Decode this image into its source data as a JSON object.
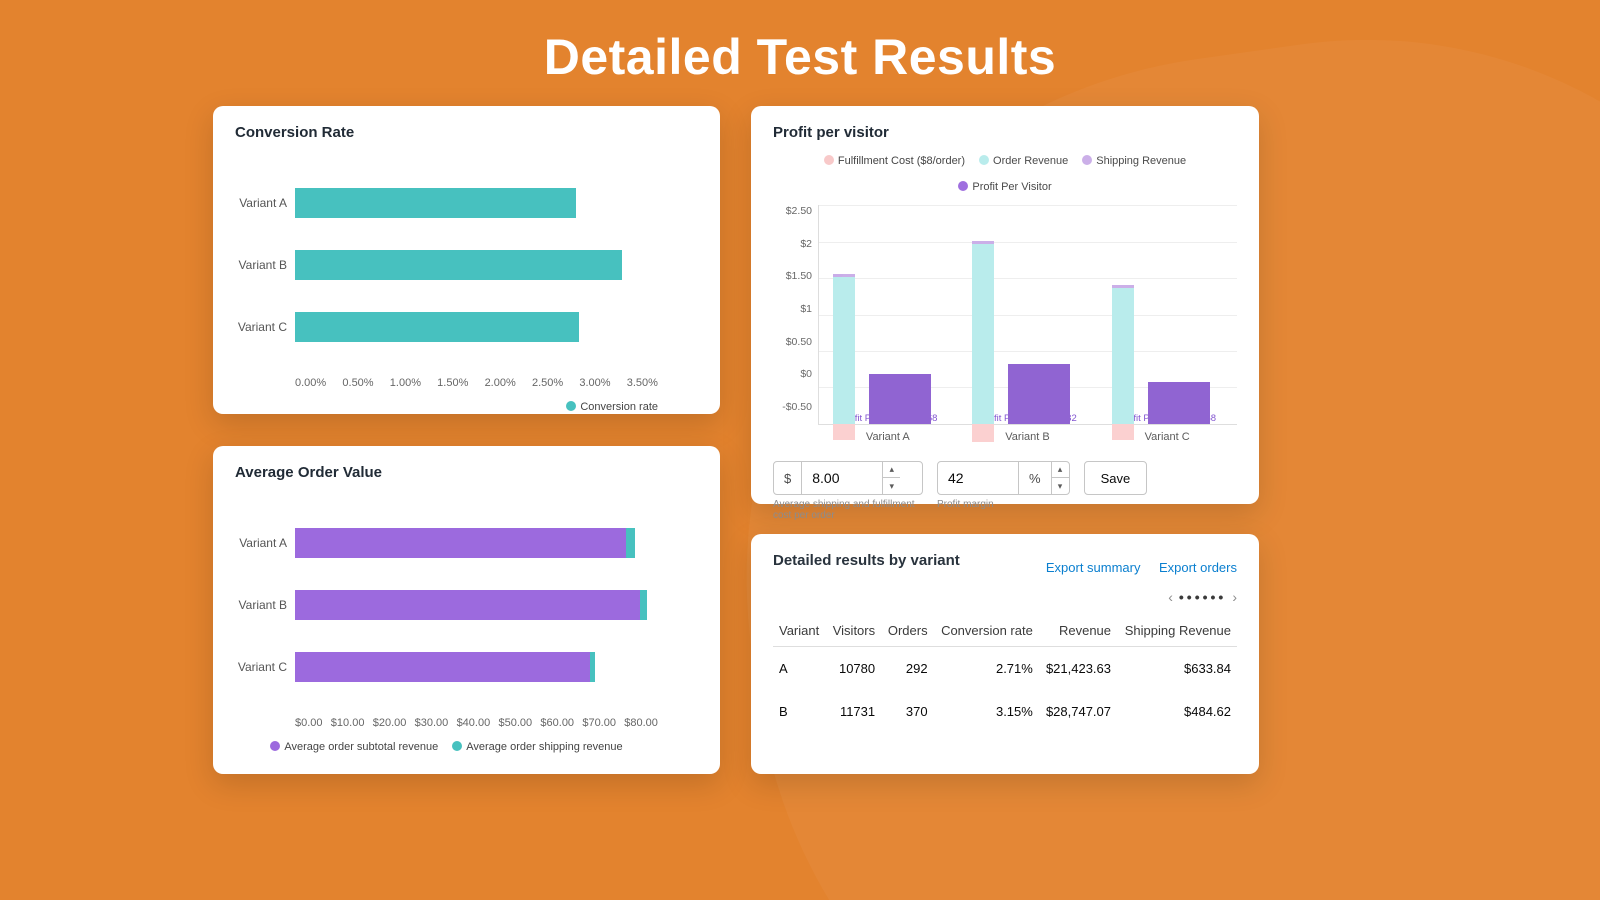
{
  "page_title": "Detailed Test Results",
  "chart_data": [
    {
      "id": "conversion_rate",
      "type": "bar",
      "orientation": "horizontal",
      "title": "Conversion Rate",
      "categories": [
        "Variant A",
        "Variant B",
        "Variant C"
      ],
      "series": [
        {
          "name": "Conversion rate",
          "color": "#47c1bf",
          "values": [
            0.0271,
            0.0315,
            0.0274
          ]
        }
      ],
      "xlabel": "",
      "ylabel": "",
      "xticks": [
        "0.00%",
        "0.50%",
        "1.00%",
        "1.50%",
        "2.00%",
        "2.50%",
        "3.00%",
        "3.50%"
      ],
      "xlim": [
        0,
        0.035
      ],
      "legend": [
        "Conversion rate"
      ]
    },
    {
      "id": "average_order_value",
      "type": "bar",
      "orientation": "horizontal",
      "stacked": true,
      "title": "Average Order Value",
      "categories": [
        "Variant A",
        "Variant B",
        "Variant C"
      ],
      "series": [
        {
          "name": "Average order subtotal revenue",
          "color": "#9c6ade",
          "values": [
            73,
            76,
            65
          ]
        },
        {
          "name": "Average order shipping revenue",
          "color": "#47c1bf",
          "values": [
            2,
            1.5,
            1
          ]
        }
      ],
      "xlabel": "",
      "ylabel": "",
      "xticks": [
        "$0.00",
        "$10.00",
        "$20.00",
        "$30.00",
        "$40.00",
        "$50.00",
        "$60.00",
        "$70.00",
        "$80.00"
      ],
      "xlim": [
        0,
        80
      ],
      "legend": [
        "Average order subtotal revenue",
        "Average order shipping revenue"
      ]
    },
    {
      "id": "profit_per_visitor",
      "type": "bar",
      "orientation": "vertical",
      "grouped": true,
      "title": "Profit per visitor",
      "categories": [
        "Variant A",
        "Variant B",
        "Variant C"
      ],
      "series": [
        {
          "name": "Fulfillment Cost ($8/order)",
          "color": "#fbcfcf",
          "values": [
            -0.22,
            -0.25,
            -0.22
          ]
        },
        {
          "name": "Order Revenue",
          "color": "#b7ecec",
          "values": [
            2.0,
            2.45,
            1.85
          ]
        },
        {
          "name": "Shipping Revenue",
          "color": "#c9ace8",
          "values": [
            0.05,
            0.04,
            0.04
          ]
        },
        {
          "name": "Profit Per Visitor",
          "color": "#8c5ed1",
          "values": [
            0.68,
            0.82,
            0.58
          ]
        }
      ],
      "annotations": [
        "Profit Per Visitor: $0.68",
        "Profit Per Visitor: $0.82",
        "Profit Per Visitor: $0.58"
      ],
      "yticks": [
        "$2.50",
        "$2",
        "$1.50",
        "$1",
        "$0.50",
        "$0",
        "-$0.50"
      ],
      "ylim": [
        -0.5,
        2.5
      ],
      "legend": [
        "Fulfillment Cost ($8/order)",
        "Order Revenue",
        "Shipping Revenue",
        "Profit Per Visitor"
      ]
    }
  ],
  "profit_inputs": {
    "cost_prefix": "$",
    "cost_value": "8.00",
    "cost_caption": "Average shipping and fulfillment cost per order",
    "margin_value": "42",
    "margin_suffix": "%",
    "margin_caption": "Profit margin",
    "save_label": "Save"
  },
  "results_table": {
    "title": "Detailed results by variant",
    "links": {
      "export_summary": "Export summary",
      "export_orders": "Export orders"
    },
    "columns": [
      "Variant",
      "Visitors",
      "Orders",
      "Conversion rate",
      "Revenue",
      "Shipping Revenue"
    ],
    "rows": [
      {
        "variant": "A",
        "visitors": "10780",
        "orders": "292",
        "cr": "2.71%",
        "rev": "$21,423.63",
        "ship": "$633.84"
      },
      {
        "variant": "B",
        "visitors": "11731",
        "orders": "370",
        "cr": "3.15%",
        "rev": "$28,747.07",
        "ship": "$484.62"
      }
    ],
    "pager_dots": "••••••"
  }
}
